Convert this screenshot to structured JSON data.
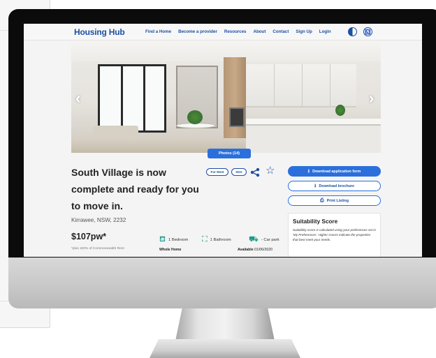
{
  "site": {
    "logo": "Housing Hub",
    "nav": [
      "Find a Home",
      "Become a provider",
      "Resources",
      "About",
      "Contact",
      "Sign Up",
      "Login"
    ],
    "icons": [
      "contrast-icon",
      "accessibility-icon"
    ],
    "accent_color": "#1e4fa3",
    "button_color": "#2a6fdc"
  },
  "gallery": {
    "photos_label": "Photos (14)",
    "prev_icon": "chevron-left-icon",
    "next_icon": "chevron-right-icon"
  },
  "listing": {
    "title": "South Village is now complete and ready for you to move in.",
    "tags": [
      "For Rent",
      "SDA"
    ],
    "suburb": "Kirrawee, NSW, 2232",
    "price": "$107pw*",
    "price_note": "*plus 100% of Commonwealth Rent",
    "features": {
      "bedrooms": "1 Bedroom",
      "bathrooms": "1 Bathroom",
      "parking": "- Car park"
    },
    "type": "Whole Home",
    "available_label": "Available",
    "available_date": "01/06/2020"
  },
  "actions": {
    "download_form": "Download application form",
    "download_brochure": "Download brochure",
    "print": "Print Listing"
  },
  "suitability": {
    "title": "Suitability Score",
    "description": "Suitability score is calculated using your preferences set in 'My Preferences'. Higher scores indicate the properties that best meet your needs."
  }
}
